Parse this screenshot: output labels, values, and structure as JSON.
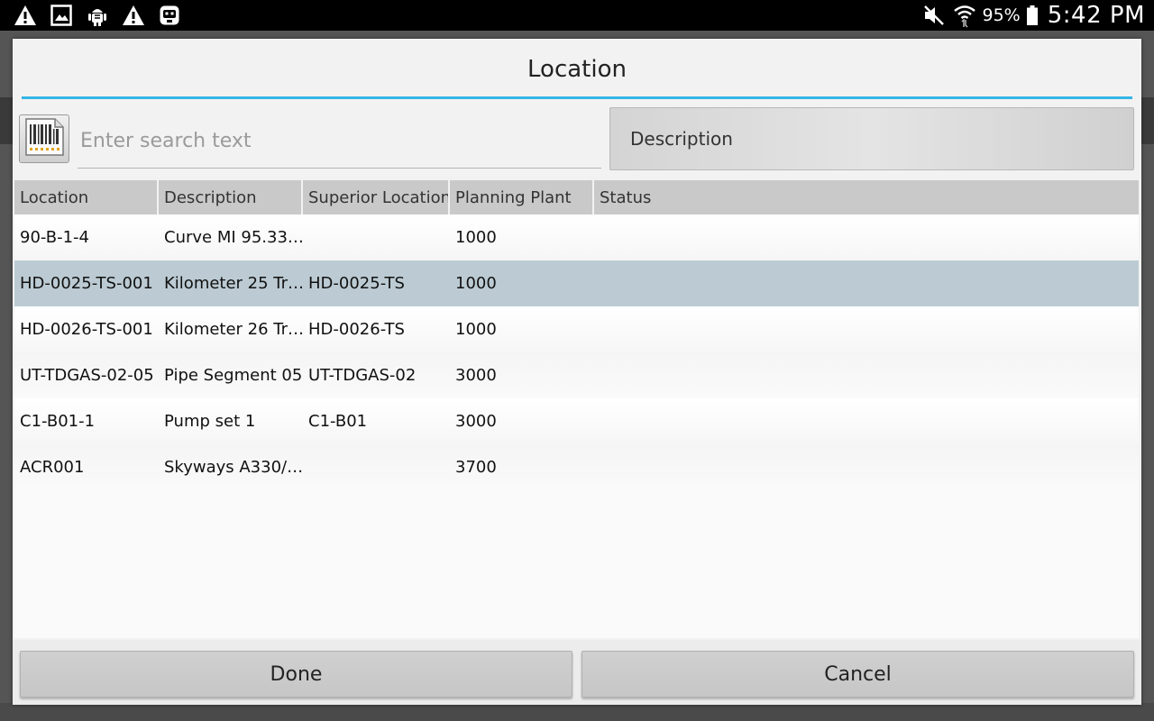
{
  "statusbar": {
    "left_icons": [
      "warning-icon",
      "image-icon",
      "android-debug-icon",
      "warning-icon",
      "robot-icon"
    ],
    "battery_percent": "95%",
    "time": "5:42 PM"
  },
  "dialog": {
    "title": "Location",
    "search": {
      "placeholder": "Enter search text",
      "value": ""
    },
    "search_field_label": "Description",
    "table": {
      "columns": [
        "Location",
        "Description",
        "Superior Location",
        "Planning Plant",
        "Status"
      ],
      "rows": [
        [
          "90-B-1-4",
          "Curve MI 95.33…",
          "",
          "1000",
          ""
        ],
        [
          "HD-0025-TS-001",
          "Kilometer 25 Tr…",
          "HD-0025-TS",
          "1000",
          ""
        ],
        [
          "HD-0026-TS-001",
          "Kilometer 26 Tr…",
          "HD-0026-TS",
          "1000",
          ""
        ],
        [
          "UT-TDGAS-02-05",
          "Pipe Segment 05",
          "UT-TDGAS-02",
          "3000",
          ""
        ],
        [
          "C1-B01-1",
          "Pump set 1",
          "C1-B01",
          "3000",
          ""
        ],
        [
          "ACR001",
          "Skyways A330/…",
          "",
          "3700",
          ""
        ]
      ],
      "selected_row": 1
    },
    "done_label": "Done",
    "cancel_label": "Cancel"
  },
  "colors": {
    "accent": "#33b5e5",
    "selected_row": "#bccbd3"
  }
}
